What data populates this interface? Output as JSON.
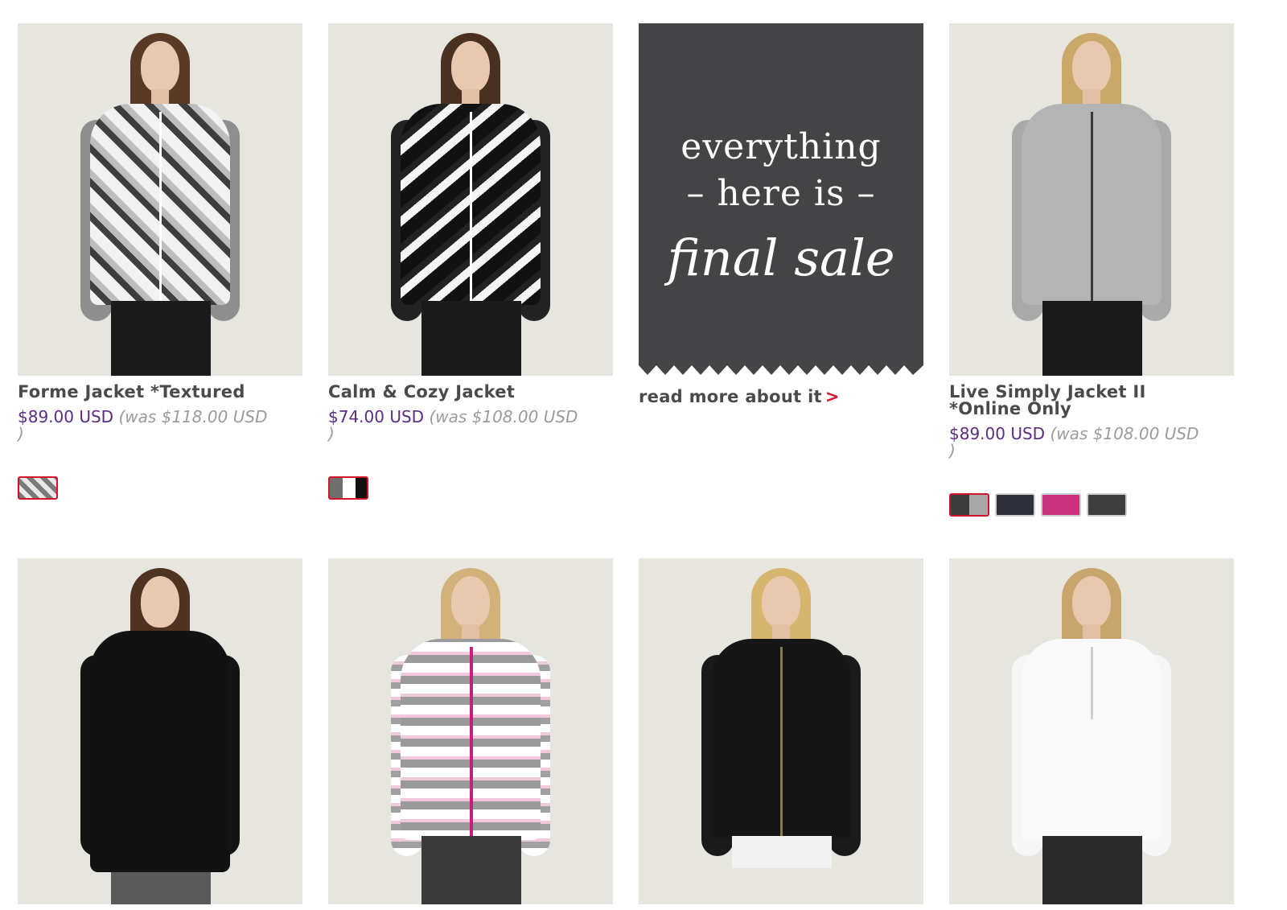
{
  "products_row1": [
    {
      "title": "Forme Jacket *Textured",
      "price": "$89.00 USD",
      "was_text": "(was $118.00 USD",
      "was_close": ")",
      "swatches": [
        {
          "name": "print-swatch",
          "colors": [
            "#7a7a7a",
            "#e8e8e8"
          ],
          "selected": true
        }
      ]
    },
    {
      "title": "Calm & Cozy Jacket",
      "price": "$74.00 USD",
      "was_text": "(was $108.00 USD",
      "was_close": ")",
      "swatches": [
        {
          "name": "print-black-swatch",
          "colors": [
            "#6f6f6f",
            "#ffffff",
            "#111111"
          ],
          "selected": true
        }
      ]
    },
    {
      "title": "Live Simply Jacket II\n*Online Only",
      "price": "$89.00 USD",
      "was_text": "(was $108.00 USD",
      "was_close": ")",
      "swatches": [
        {
          "name": "charcoal-grey-swatch",
          "colors": [
            "#3c3c3c",
            "#a8a8a8"
          ],
          "selected": true
        },
        {
          "name": "navy-swatch",
          "colors": [
            "#2f323d"
          ],
          "selected": false
        },
        {
          "name": "pink-swatch",
          "colors": [
            "#c9317b"
          ],
          "selected": false
        },
        {
          "name": "dark-grey-swatch",
          "colors": [
            "#3f3f40"
          ],
          "selected": false
        }
      ]
    }
  ],
  "sale_banner": {
    "line1": "everything",
    "line2": "– here is –",
    "line3": "final sale",
    "read_more": "read more about it",
    "chevron": ">"
  },
  "colors": {
    "price": "#5b2c83",
    "was": "#9b9b9b",
    "accent_red": "#d2142c",
    "banner_bg": "#444345",
    "photo_bg": "#e6e6df"
  }
}
